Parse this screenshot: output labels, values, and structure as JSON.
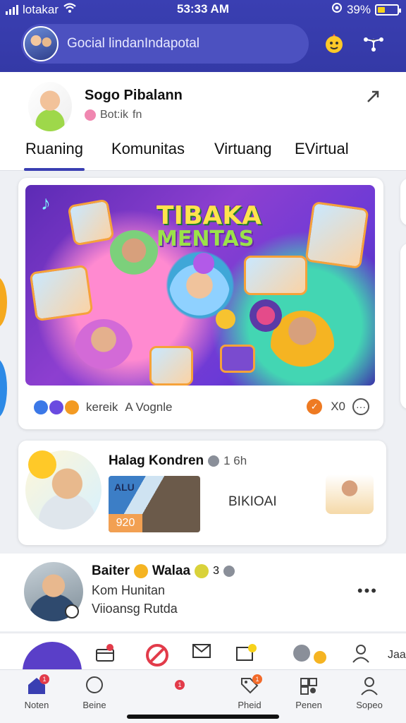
{
  "status": {
    "carrier": "lotakar",
    "time": "53:33 AM",
    "battery": "39%",
    "battery_level": 0.39
  },
  "search": {
    "placeholder": "Gocial lindanIndapotal"
  },
  "profile": {
    "name": "Sogo Pibalann",
    "sub": "Bot:ik",
    "sub_icon": "fn"
  },
  "tabs": [
    "Ruaning",
    "Komunitas",
    "Virtuang",
    "EVirtual"
  ],
  "post1": {
    "banner_title_1": "TIBAKA",
    "banner_title_2": "MENTAS",
    "reactions_label": "kereik",
    "share_label": "A Vognle",
    "count": "X0"
  },
  "post2": {
    "name": "Halag Kondren",
    "time": "1 6h",
    "thumb_label": "920",
    "thumb_top": "ALU",
    "side_text": "BIKIOAI"
  },
  "post3": {
    "name": "Baiter",
    "name2": "Walaa",
    "count": "3",
    "line1": "Kom Hunitan",
    "line2": "Viioansg Rutda"
  },
  "stories": {
    "end_label": "Jaa"
  },
  "nav": [
    {
      "label": "Noten",
      "icon": "home-icon"
    },
    {
      "label": "Beine",
      "icon": "chat-bubble-icon"
    },
    {
      "label": "",
      "icon": "camera-icon"
    },
    {
      "label": "Pheid",
      "icon": "tag-icon"
    },
    {
      "label": "Penen",
      "icon": "grid-icon"
    },
    {
      "label": "Sopeo",
      "icon": "person-icon"
    }
  ]
}
